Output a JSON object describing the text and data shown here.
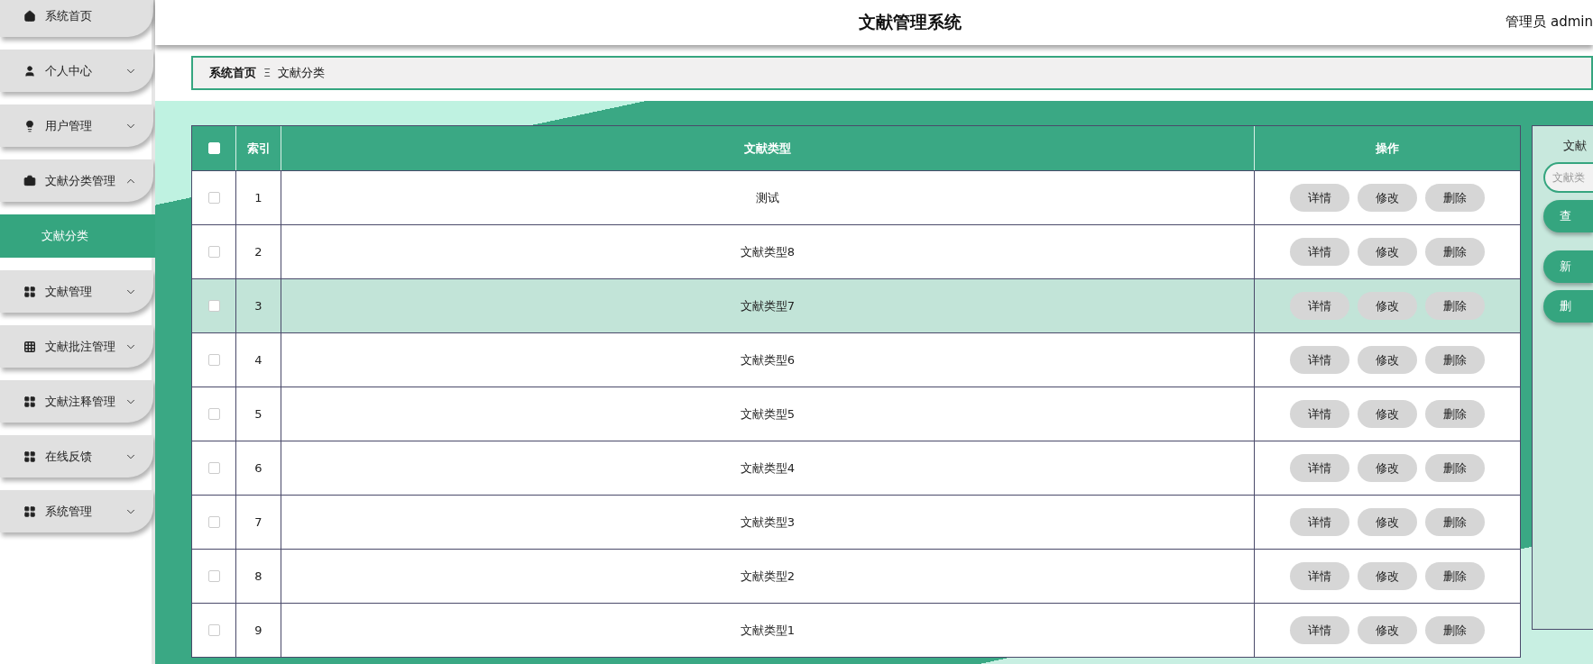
{
  "sidebar": {
    "items": [
      {
        "label": "系统首页",
        "kind": "home",
        "expandable": false,
        "expanded": false
      },
      {
        "label": "个人中心",
        "kind": "user",
        "expandable": true,
        "expanded": false
      },
      {
        "label": "用户管理",
        "kind": "bulb",
        "expandable": true,
        "expanded": false
      },
      {
        "label": "文献分类管理",
        "kind": "briefcase",
        "expandable": true,
        "expanded": true,
        "children": [
          {
            "label": "文献分类",
            "selected": true
          }
        ]
      },
      {
        "label": "文献管理",
        "kind": "grid",
        "expandable": true,
        "expanded": false
      },
      {
        "label": "文献批注管理",
        "kind": "grid9",
        "expandable": true,
        "expanded": false
      },
      {
        "label": "文献注释管理",
        "kind": "grid",
        "expandable": true,
        "expanded": false
      },
      {
        "label": "在线反馈",
        "kind": "grid",
        "expandable": true,
        "expanded": false
      },
      {
        "label": "系统管理",
        "kind": "grid",
        "expandable": true,
        "expanded": false
      }
    ]
  },
  "header": {
    "title": "文献管理系统",
    "user": "管理员 admin"
  },
  "breadcrumb": {
    "home": "系统首页",
    "separator": "Ξ",
    "current": "文献分类"
  },
  "table": {
    "header_checked": false,
    "columns": [
      "索引",
      "文献类型",
      "操作"
    ],
    "rows": [
      {
        "checked": false,
        "highlighted": false,
        "index": "1",
        "type": "测试",
        "actions": [
          "详情",
          "修改",
          "删除"
        ]
      },
      {
        "checked": false,
        "highlighted": false,
        "index": "2",
        "type": "文献类型8",
        "actions": [
          "详情",
          "修改",
          "删除"
        ]
      },
      {
        "checked": false,
        "highlighted": true,
        "index": "3",
        "type": "文献类型7",
        "actions": [
          "详情",
          "修改",
          "删除"
        ]
      },
      {
        "checked": false,
        "highlighted": false,
        "index": "4",
        "type": "文献类型6",
        "actions": [
          "详情",
          "修改",
          "删除"
        ]
      },
      {
        "checked": false,
        "highlighted": false,
        "index": "5",
        "type": "文献类型5",
        "actions": [
          "详情",
          "修改",
          "删除"
        ]
      },
      {
        "checked": false,
        "highlighted": false,
        "index": "6",
        "type": "文献类型4",
        "actions": [
          "详情",
          "修改",
          "删除"
        ]
      },
      {
        "checked": false,
        "highlighted": false,
        "index": "7",
        "type": "文献类型3",
        "actions": [
          "详情",
          "修改",
          "删除"
        ]
      },
      {
        "checked": false,
        "highlighted": false,
        "index": "8",
        "type": "文献类型2",
        "actions": [
          "详情",
          "修改",
          "删除"
        ]
      },
      {
        "checked": false,
        "highlighted": false,
        "index": "9",
        "type": "文献类型1",
        "actions": [
          "详情",
          "修改",
          "删除"
        ]
      }
    ]
  },
  "search_panel": {
    "label": "文献",
    "placeholder": "文献类",
    "buttons": [
      "查",
      "新",
      "删"
    ]
  }
}
